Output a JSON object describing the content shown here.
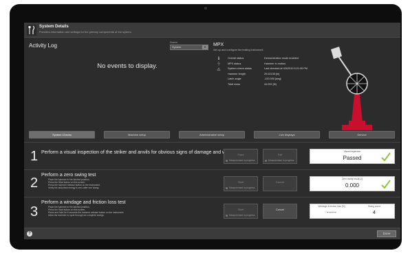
{
  "header": {
    "title": "System Details",
    "subtitle": "Provides information and settings for the primary components of the system"
  },
  "activity_log": {
    "title": "Activity Log",
    "empty_message": "No events to display.",
    "source_label": "Source",
    "source_value": "System"
  },
  "mpx": {
    "title": "MPX",
    "subtitle": "Set up and configure the testing instrument.",
    "status_icons": [
      "info-icon",
      "pendulum-status-icon",
      "warning-icon"
    ],
    "rows": [
      {
        "key": "Overall status",
        "value": "Demonstration mode enabled"
      },
      {
        "key": "MPX status",
        "value": "Hammer in motion"
      },
      {
        "key": "System check status",
        "value": "Last checked at 4/9/2019 5:21:05 PM"
      },
      {
        "key": "Hammer length",
        "value": "25.02135 [m]"
      },
      {
        "key": "Latch angle",
        "value": "-120.000 [deg]"
      },
      {
        "key": "Total mass",
        "value": "44.092 [lb]"
      }
    ],
    "accent_color": "#c8102e"
  },
  "tabs": [
    "System Checks",
    "Machine setup",
    "Administrative setup",
    "Live displays",
    "Service"
  ],
  "active_tab": 0,
  "checks": [
    {
      "number": "1",
      "title": "Perform a visual inspection of the striker and anvils for obvious signs of damage and wear.",
      "steps": [],
      "btn1": "Pass",
      "btn2": "Fail",
      "progress": "Measurement in progress",
      "result_label": "Visual inspection",
      "result_value": "Passed",
      "checked": true
    },
    {
      "number": "2",
      "title": "Perform a zero swing test",
      "steps": [
        "Place the hammer in the latched position.",
        "Press the Start button on this screen.",
        "Press the hammer release button on the instrument.",
        "Verify the absorbed energy is zero after one swing."
      ],
      "btn1": "Start",
      "btn2": "Cancel",
      "progress": "Measurement in progress",
      "result_label": "Zero swing result [J]",
      "result_value": "0.000",
      "checked": true
    },
    {
      "number": "3",
      "title": "Perform a windage and friction loss test",
      "steps": [
        "Place the hammer in the latched position.",
        "Press the Start button on this screen.",
        "Press and hold for 5 seconds the hammer release button on the instrument.",
        "Allow the hammer to cycle through six complete swings."
      ],
      "btn1": "Start",
      "btn2": "Cancel",
      "progress": "Measurement in progress",
      "result_label_a": "Windage & friction loss [%]",
      "result_value_a": "------",
      "result_label_b": "Swing count",
      "result_value_b": "4"
    }
  ],
  "footer": {
    "help": "?",
    "done": "Done"
  }
}
